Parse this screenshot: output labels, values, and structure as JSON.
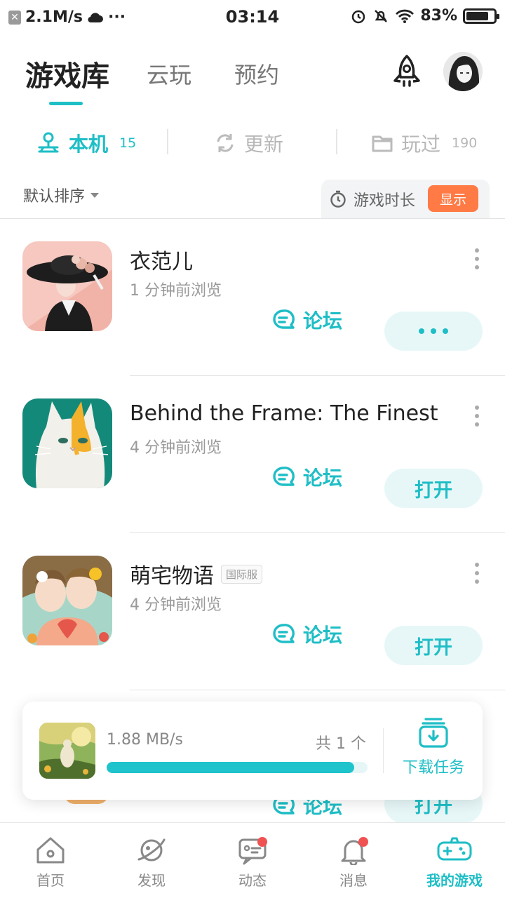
{
  "status_bar": {
    "net_speed": "2.1M/s",
    "time": "03:14",
    "battery": "83%",
    "battery_level": 0.83,
    "more": "···"
  },
  "header": {
    "tabs": [
      {
        "label": "游戏库",
        "active": true
      },
      {
        "label": "云玩",
        "active": false
      },
      {
        "label": "预约",
        "active": false
      }
    ],
    "rocket_icon": "rocket-icon",
    "avatar_icon": "avatar"
  },
  "subtabs": [
    {
      "label": "本机",
      "count": "15",
      "icon": "device-icon",
      "active": true
    },
    {
      "label": "更新",
      "count": "",
      "icon": "refresh-icon",
      "active": false
    },
    {
      "label": "玩过",
      "count": "190",
      "icon": "folder-icon",
      "active": false
    }
  ],
  "sort": {
    "label": "默认排序",
    "time_label": "游戏时长",
    "show_button": "显示"
  },
  "games": [
    {
      "title": "衣范儿",
      "tag": "",
      "subtitle": "1 分钟前浏览",
      "forum": "论坛",
      "action": "",
      "action_is_dots": true
    },
    {
      "title": "Behind the Frame: The Finest…",
      "tag": "",
      "subtitle": "4 分钟前浏览",
      "forum": "论坛",
      "action": "打开",
      "action_is_dots": false
    },
    {
      "title": "萌宅物语",
      "tag": "国际服",
      "subtitle": "4 分钟前浏览",
      "forum": "论坛",
      "action": "打开",
      "action_is_dots": false
    }
  ],
  "partial_item": {
    "forum": "论坛",
    "action": "打开"
  },
  "download": {
    "speed": "1.88 MB/s",
    "count": "共 1 个",
    "progress": 0.95,
    "task_label": "下载任务"
  },
  "bottom_nav": [
    {
      "label": "首页",
      "icon": "home-icon",
      "badge": false,
      "active": false
    },
    {
      "label": "发现",
      "icon": "planet-icon",
      "badge": false,
      "active": false
    },
    {
      "label": "动态",
      "icon": "chat-icon",
      "badge": true,
      "active": false
    },
    {
      "label": "消息",
      "icon": "bell-icon",
      "badge": true,
      "active": false
    },
    {
      "label": "我的游戏",
      "icon": "gamepad-icon",
      "badge": false,
      "active": true
    }
  ],
  "colors": {
    "accent": "#1ebec6",
    "orange": "#ff7a45",
    "badge_red": "#f05252"
  }
}
